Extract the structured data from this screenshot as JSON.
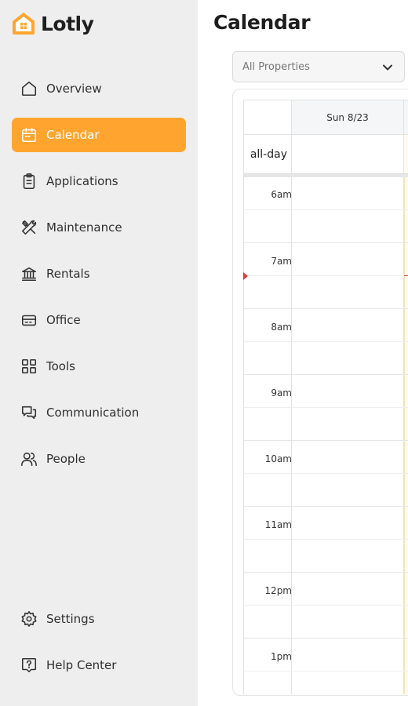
{
  "brand": {
    "name": "Lotly",
    "accent": "#ffa52f"
  },
  "nav": {
    "top": [
      {
        "label": "Overview",
        "icon": "home-icon",
        "active": false
      },
      {
        "label": "Calendar",
        "icon": "calendar-icon",
        "active": true
      },
      {
        "label": "Applications",
        "icon": "clipboard-icon",
        "active": false
      },
      {
        "label": "Maintenance",
        "icon": "tools-icon",
        "active": false
      },
      {
        "label": "Rentals",
        "icon": "bank-icon",
        "active": false
      },
      {
        "label": "Office",
        "icon": "card-icon",
        "active": false
      },
      {
        "label": "Tools",
        "icon": "grid-icon",
        "active": false
      },
      {
        "label": "Communication",
        "icon": "chat-icon",
        "active": false
      },
      {
        "label": "People",
        "icon": "users-icon",
        "active": false
      }
    ],
    "bottom": [
      {
        "label": "Settings",
        "icon": "gear-icon"
      },
      {
        "label": "Help Center",
        "icon": "help-icon"
      }
    ]
  },
  "page": {
    "title": "Calendar"
  },
  "filter": {
    "selected": "All Properties"
  },
  "calendar": {
    "day_header": "Sun 8/23",
    "all_day_label": "all-day",
    "hours": [
      "6am",
      "7am",
      "8am",
      "9am",
      "10am",
      "11am",
      "12pm",
      "1pm"
    ],
    "now_indicator_color": "#e53935"
  }
}
